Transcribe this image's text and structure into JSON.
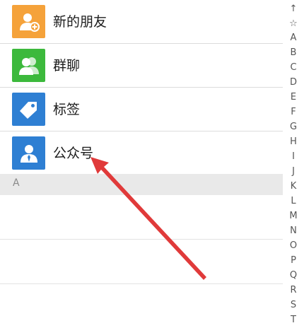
{
  "contacts": {
    "items": [
      {
        "label": "新的朋友",
        "icon": "add-friend-icon",
        "color": "#F5A23A"
      },
      {
        "label": "群聊",
        "icon": "group-chat-icon",
        "color": "#3CB93C"
      },
      {
        "label": "标签",
        "icon": "tag-icon",
        "color": "#2E7FD3"
      },
      {
        "label": "公众号",
        "icon": "official-account-icon",
        "color": "#2E7FD3"
      }
    ],
    "section_header": "A"
  },
  "index_bar": {
    "letters": [
      "↑",
      "☆",
      "A",
      "B",
      "C",
      "D",
      "E",
      "F",
      "G",
      "H",
      "I",
      "J",
      "K",
      "L",
      "M",
      "N",
      "O",
      "P",
      "Q",
      "R",
      "S",
      "T"
    ]
  },
  "annotation": {
    "arrow_color": "#E03A3A"
  }
}
